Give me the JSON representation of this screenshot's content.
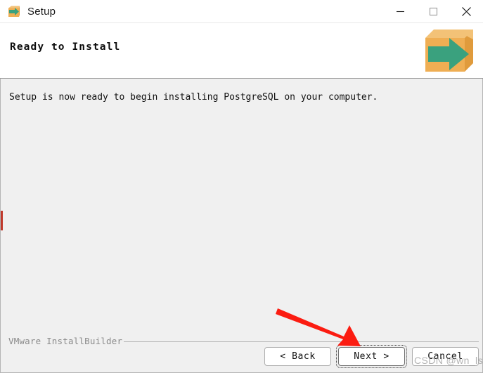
{
  "window": {
    "title": "Setup",
    "title_icon": "package-arrow-icon",
    "controls": [
      {
        "name": "minimize",
        "glyph": "minimize-icon"
      },
      {
        "name": "maximize",
        "glyph": "maximize-icon"
      },
      {
        "name": "close",
        "glyph": "close-icon"
      }
    ]
  },
  "header": {
    "title": "Ready to Install",
    "icon": "package-arrow-icon"
  },
  "main": {
    "message": "Setup is now ready to begin installing PostgreSQL on your computer."
  },
  "footer": {
    "brand": "VMware InstallBuilder",
    "buttons": [
      {
        "label": "< Back",
        "name": "back-button",
        "focused": false
      },
      {
        "label": "Next >",
        "name": "next-button",
        "focused": true
      },
      {
        "label": "Cancel",
        "name": "cancel-button",
        "focused": false
      }
    ]
  },
  "annotation": {
    "arrow": "red-arrow-pointing-to-next-button",
    "arrow_color": "#FB1C11"
  },
  "watermark": {
    "text": "CSDN @wn_lsb"
  },
  "colors": {
    "body_background": "#F0F0F0",
    "header_background": "#FFFFFF",
    "box_orange": "#EFAE53",
    "arrow_green": "#3AA17E",
    "edge_mark_red": "#C0392B"
  }
}
